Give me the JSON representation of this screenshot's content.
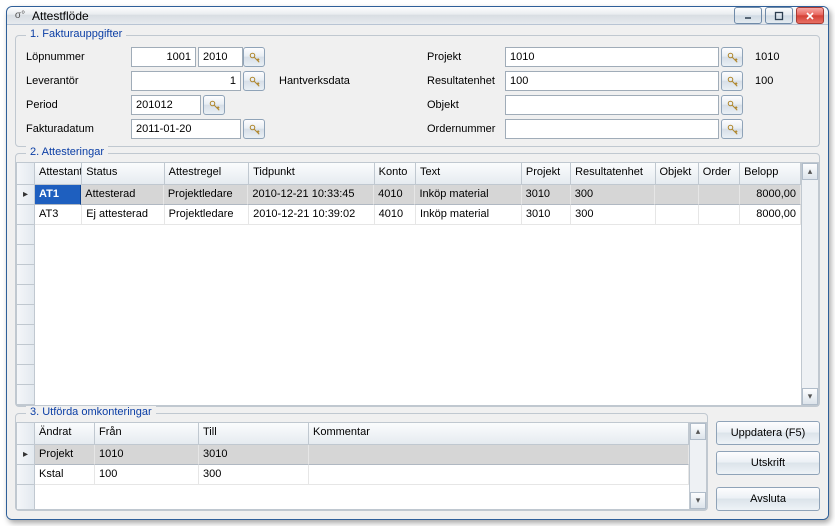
{
  "window": {
    "title": "Attestflöde"
  },
  "group1": {
    "title": "1. Fakturauppgifter",
    "labels": {
      "lopnummer": "Löpnummer",
      "leverantor": "Leverantör",
      "period": "Period",
      "fakturadatum": "Fakturadatum",
      "projekt": "Projekt",
      "resultatenhet": "Resultatenhet",
      "objekt": "Objekt",
      "ordernummer": "Ordernummer",
      "hantverksdata": "Hantverksdata"
    },
    "values": {
      "lopnummer_a": "1001",
      "lopnummer_b": "2010",
      "leverantor": "1",
      "period": "201012",
      "fakturadatum": "2011-01-20",
      "projekt": "1010",
      "projekt_disp": "1010",
      "resultatenhet": "100",
      "resultatenhet_disp": "100",
      "objekt": "",
      "ordernummer": ""
    }
  },
  "group2": {
    "title": "2. Attesteringar",
    "headers": {
      "attestant": "Attestant",
      "status": "Status",
      "attestregel": "Attestregel",
      "tidpunkt": "Tidpunkt",
      "konto": "Konto",
      "text": "Text",
      "projekt": "Projekt",
      "resultatenhet": "Resultatenhet",
      "objekt": "Objekt",
      "order": "Order",
      "belopp": "Belopp"
    },
    "rows": [
      {
        "attestant": "AT1",
        "status": "Attesterad",
        "attestregel": "Projektledare",
        "tidpunkt": "2010-12-21 10:33:45",
        "konto": "4010",
        "text": "Inköp material",
        "projekt": "3010",
        "resultatenhet": "300",
        "objekt": "",
        "order": "",
        "belopp": "8000,00",
        "selected": true
      },
      {
        "attestant": "AT3",
        "status": "Ej attesterad",
        "attestregel": "Projektledare",
        "tidpunkt": "2010-12-21 10:39:02",
        "konto": "4010",
        "text": "Inköp material",
        "projekt": "3010",
        "resultatenhet": "300",
        "objekt": "",
        "order": "",
        "belopp": "8000,00",
        "selected": false
      }
    ]
  },
  "group3": {
    "title": "3. Utförda omkonteringar",
    "headers": {
      "andrat": "Ändrat",
      "fran": "Från",
      "till": "Till",
      "kommentar": "Kommentar"
    },
    "rows": [
      {
        "andrat": "Projekt",
        "fran": "1010",
        "till": "3010",
        "kommentar": "",
        "selected": true
      },
      {
        "andrat": "Kstal",
        "fran": "100",
        "till": "300",
        "kommentar": "",
        "selected": false
      }
    ]
  },
  "buttons": {
    "uppdatera": "Uppdatera (F5)",
    "utskrift": "Utskrift",
    "avsluta": "Avsluta"
  }
}
